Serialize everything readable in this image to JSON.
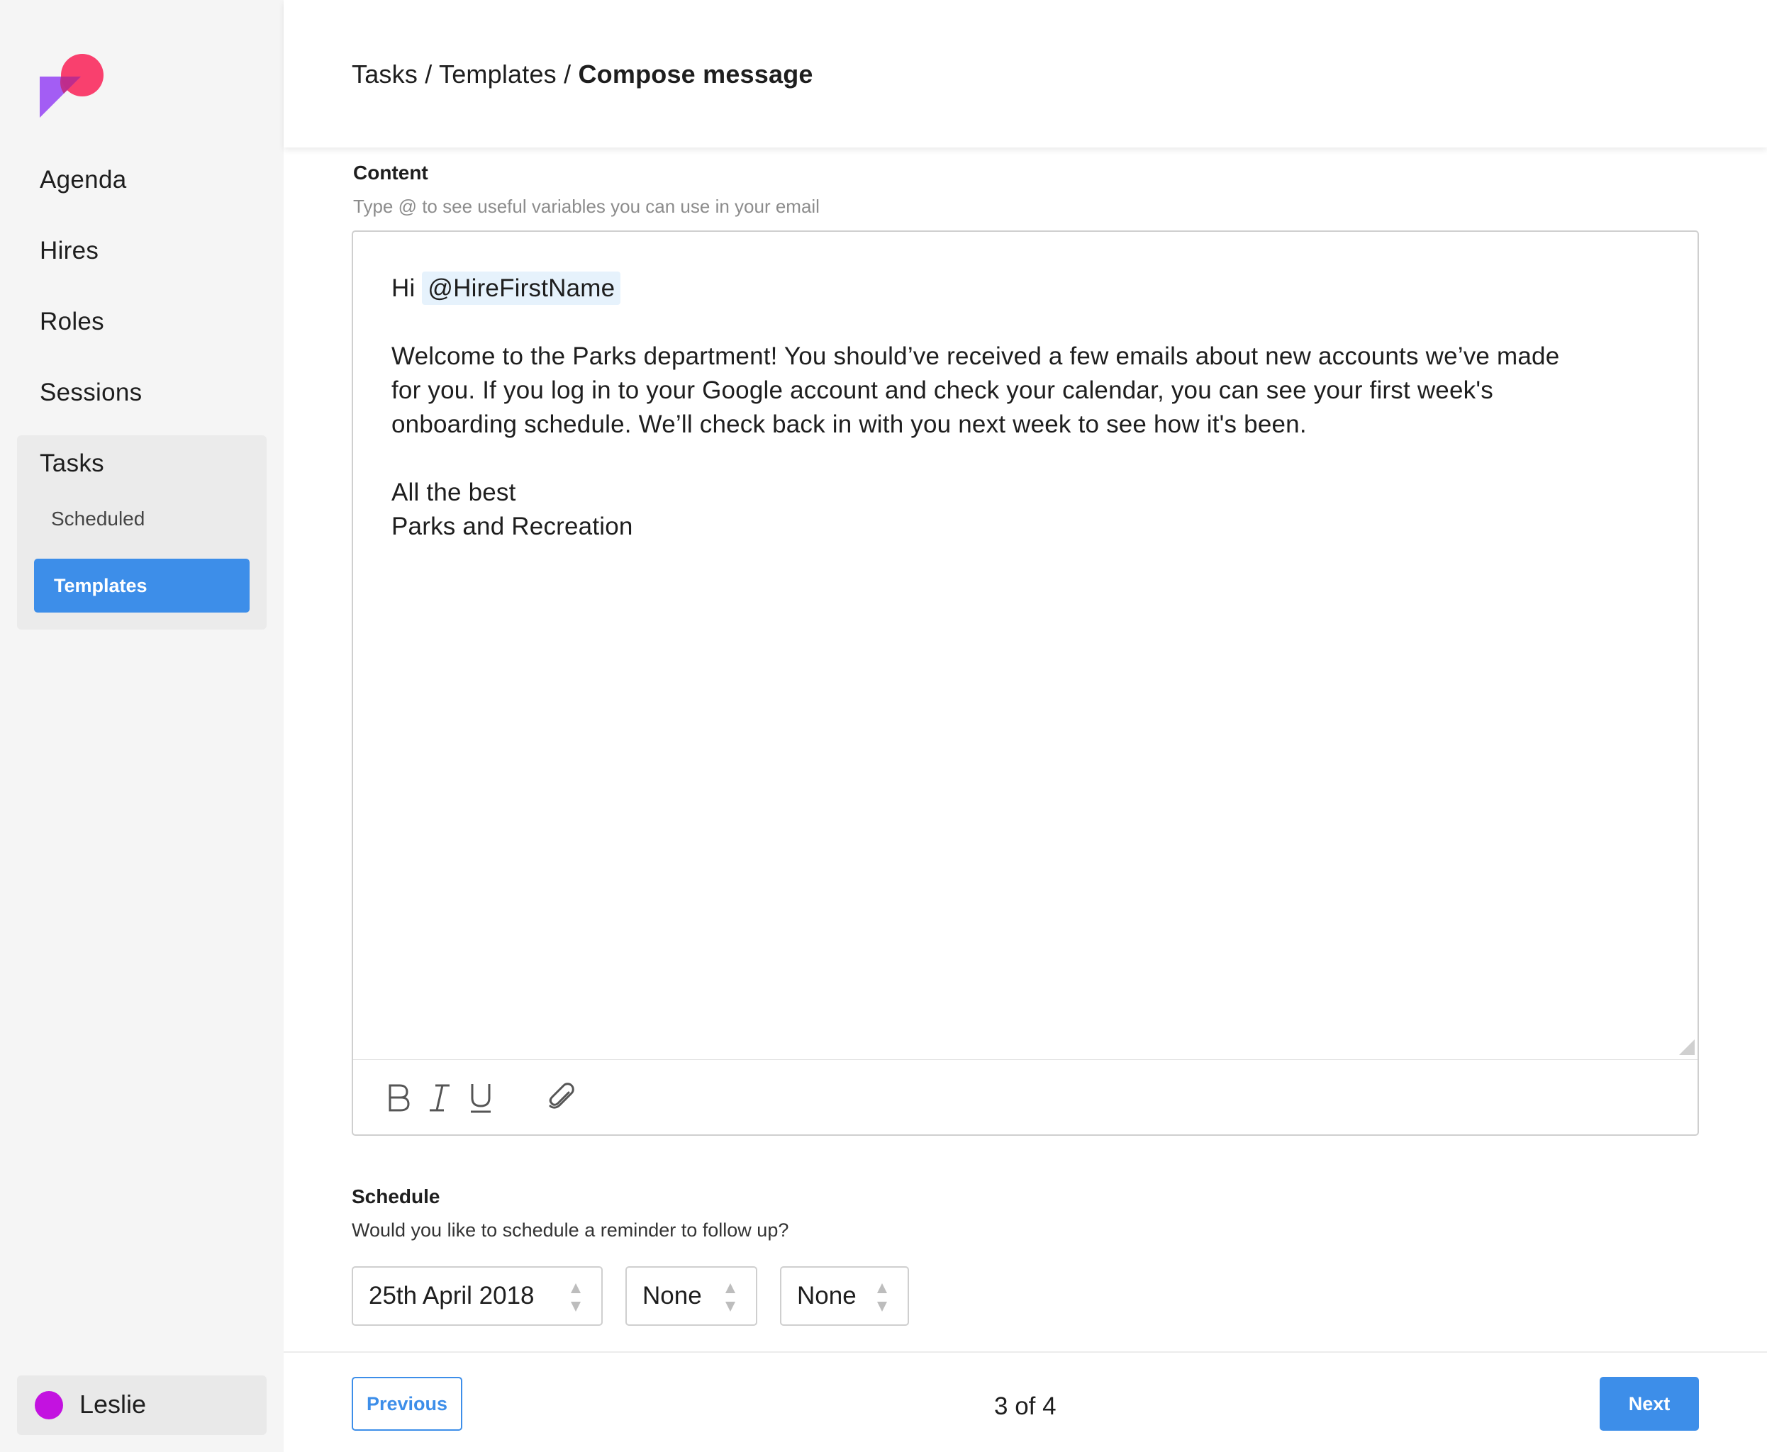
{
  "sidebar": {
    "nav": [
      {
        "label": "Agenda"
      },
      {
        "label": "Hires"
      },
      {
        "label": "Roles"
      },
      {
        "label": "Sessions"
      },
      {
        "label": "Tasks"
      }
    ],
    "subnav": [
      {
        "label": "Scheduled"
      },
      {
        "label": "Templates",
        "active": true
      }
    ],
    "user": {
      "name": "Leslie",
      "avatar_color": "#c312e0"
    }
  },
  "header": {
    "breadcrumb": [
      "Tasks",
      "Templates",
      "Compose message"
    ],
    "separator": "/"
  },
  "content": {
    "title": "Content",
    "hint": "Type @ to see useful variables you can use in your email",
    "editor": {
      "greeting": "Hi",
      "mention": "@HireFirstName",
      "paragraph_lines": [
        "Welcome to the Parks department! You should’ve received a few emails about new accounts we’ve made",
        "for you. If you log in to your Google account and check your calendar, you can see your first week's",
        "onboarding schedule. We’ll check back in with you next week to see how it's been."
      ],
      "signoff": "All the best",
      "signature": "Parks and Recreation"
    },
    "toolbar": [
      "bold-icon",
      "italic-icon",
      "underline-icon",
      "paperclip-icon"
    ]
  },
  "schedule": {
    "title": "Schedule",
    "question": "Would you like to schedule a reminder to follow up?",
    "date": "25th April 2018",
    "select2": "None",
    "select3": "None"
  },
  "footer": {
    "previous_label": "Previous",
    "page": "3 of 4",
    "next_label": "Next"
  },
  "colors": {
    "accent": "#3d8ee9",
    "sidebar_bg": "#f5f5f5",
    "mention_bg": "#e6f2fc"
  }
}
